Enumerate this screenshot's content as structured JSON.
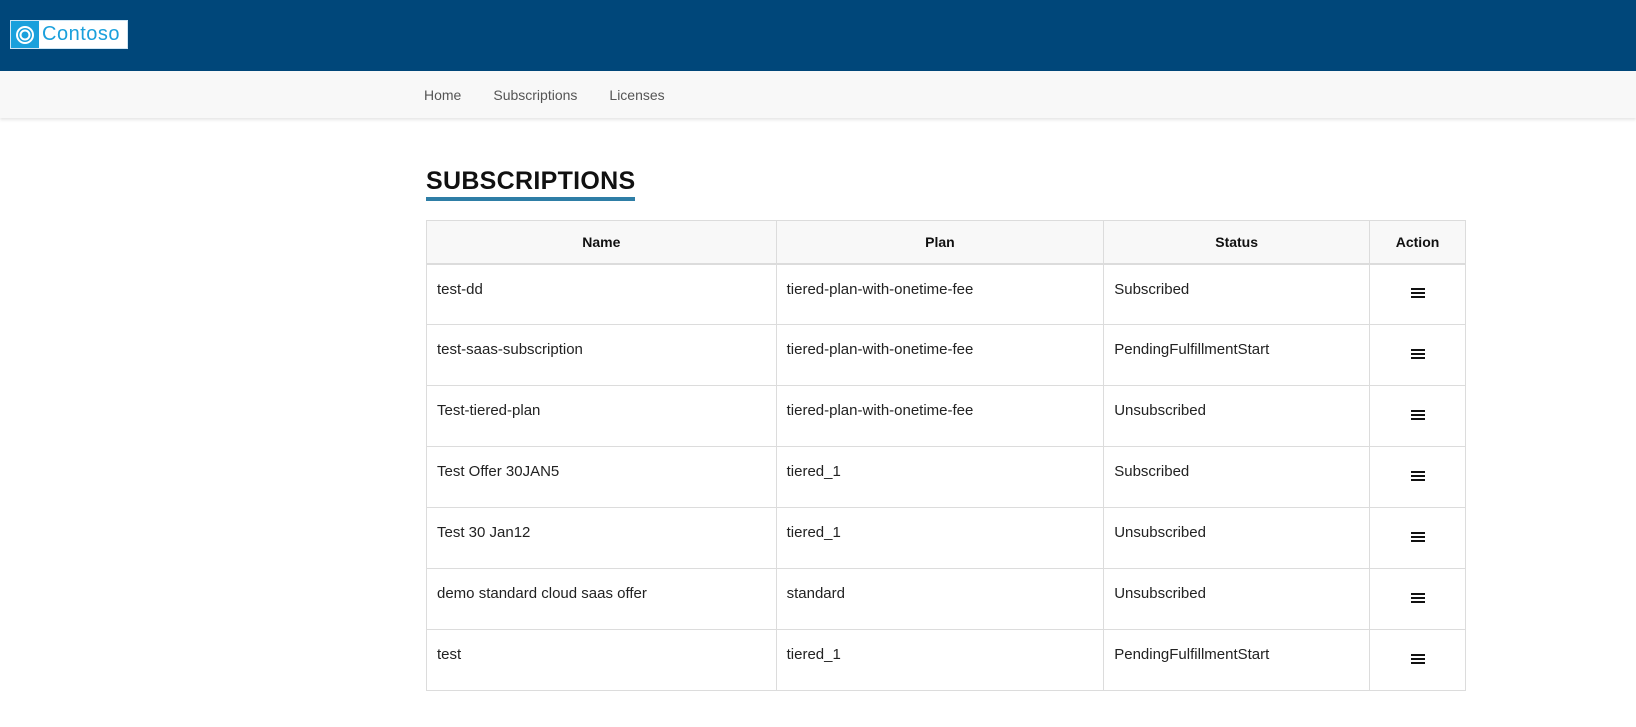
{
  "brand": {
    "name": "Contoso"
  },
  "nav": {
    "items": [
      {
        "label": "Home"
      },
      {
        "label": "Subscriptions"
      },
      {
        "label": "Licenses"
      }
    ]
  },
  "page": {
    "title": "SUBSCRIPTIONS"
  },
  "table": {
    "headers": {
      "name": "Name",
      "plan": "Plan",
      "status": "Status",
      "action": "Action"
    },
    "rows": [
      {
        "name": "test-dd",
        "plan": "tiered-plan-with-onetime-fee",
        "status": "Subscribed"
      },
      {
        "name": "test-saas-subscription",
        "plan": "tiered-plan-with-onetime-fee",
        "status": "PendingFulfillmentStart"
      },
      {
        "name": "Test-tiered-plan",
        "plan": "tiered-plan-with-onetime-fee",
        "status": "Unsubscribed"
      },
      {
        "name": "Test Offer 30JAN5",
        "plan": "tiered_1",
        "status": "Subscribed"
      },
      {
        "name": "Test 30 Jan12",
        "plan": "tiered_1",
        "status": "Unsubscribed"
      },
      {
        "name": "demo standard cloud saas offer",
        "plan": "standard",
        "status": "Unsubscribed"
      },
      {
        "name": "test",
        "plan": "tiered_1",
        "status": "PendingFulfillmentStart"
      }
    ]
  },
  "colors": {
    "topbar": "#00477a",
    "accent": "#1aa0dc",
    "title_underline": "#2e7ea6"
  },
  "icons": {
    "logo": "contoso-logo-icon",
    "row_action": "hamburger-menu-icon"
  }
}
